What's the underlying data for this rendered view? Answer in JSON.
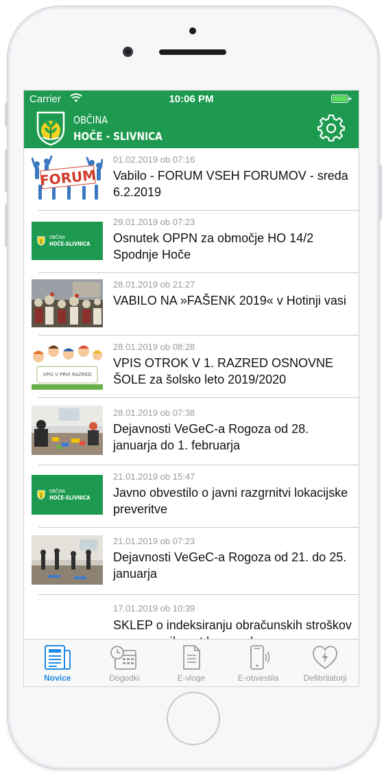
{
  "status_bar": {
    "carrier": "Carrier",
    "time": "10:06 PM"
  },
  "header": {
    "brand_line1": "OBČINA",
    "brand_line2": "HOČE - SLIVNICA"
  },
  "mini_logo": {
    "line1": "OBČINA",
    "line2": "HOČE-SLIVNICA"
  },
  "thumb_text": {
    "forum": "FORUM",
    "vpis": "VPIS V PRVI RAZRED"
  },
  "news": [
    {
      "date": "01.02.2019 ob 07:16",
      "title": "Vabilo - FORUM VSEH FORUMOV - sreda 6.2.2019",
      "thumb": "forum"
    },
    {
      "date": "29.01.2019 ob 07:23",
      "title": "Osnutek OPPN za območje HO 14/2 Spodnje Hoče",
      "thumb": "logo"
    },
    {
      "date": "28.01.2019 ob 21:27",
      "title": "VABILO NA »FAŠENK 2019« v Hotinji vasi",
      "thumb": "crowd"
    },
    {
      "date": "28.01.2019 ob 08:28",
      "title": "VPIS OTROK V 1. RAZRED OSNOVNE ŠOLE za šolsko leto 2019/2020",
      "thumb": "kids"
    },
    {
      "date": "28.01.2019 ob 07:38",
      "title": "Dejavnosti VeGeC-a Rogoza od 28. januarja do 1. februarja",
      "thumb": "workshop"
    },
    {
      "date": "21.01.2019 ob 15:47",
      "title": "Javno obvestilo o javni razgrnitvi lokacijske preveritve",
      "thumb": "logo"
    },
    {
      "date": "21.01.2019 ob 07:23",
      "title": "Dejavnosti VeGeC-a Rogoza od 21. do 25. januarja",
      "thumb": "gym"
    },
    {
      "date": "17.01.2019 ob 10:39",
      "title": "SKLEP o indeksiranju obračunskih stroškov posameznih vrst komunalne",
      "thumb": "none"
    }
  ],
  "tabs": [
    {
      "label": "Novice",
      "icon": "newspaper-icon",
      "active": true
    },
    {
      "label": "Dogodki",
      "icon": "calendar-clock-icon",
      "active": false
    },
    {
      "label": "E-vloge",
      "icon": "document-icon",
      "active": false
    },
    {
      "label": "E-obvestila",
      "icon": "phone-signal-icon",
      "active": false
    },
    {
      "label": "Defibrilatorji",
      "icon": "heart-bolt-icon",
      "active": false
    }
  ],
  "colors": {
    "brand_green": "#1d9a50",
    "tab_active": "#1e88e5",
    "tab_inactive": "#9a9a9a"
  }
}
